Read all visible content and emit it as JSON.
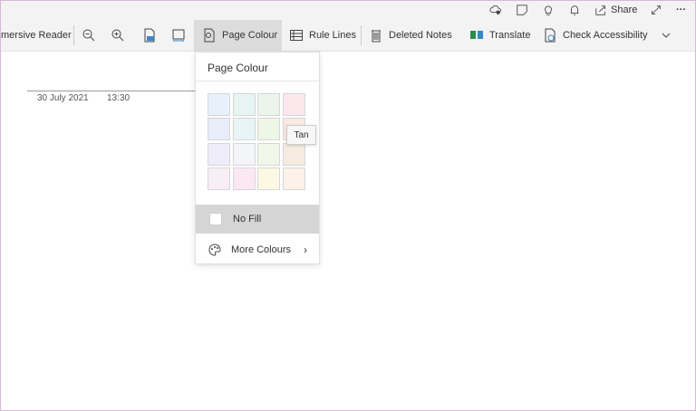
{
  "titlebar": {
    "share_label": "Share"
  },
  "toolbar": {
    "immersive_reader": "mersive Reader",
    "page_colour": "Page Colour",
    "rule_lines": "Rule Lines",
    "deleted_notes": "Deleted Notes",
    "translate": "Translate",
    "check_accessibility": "Check Accessibility"
  },
  "page": {
    "date": "30 July 2021",
    "time": "13:30"
  },
  "menu": {
    "title": "Page Colour",
    "swatches": [
      "#e8f0fc",
      "#e6f5f2",
      "#ebf5ec",
      "#fce8ec",
      "#e9ecf9",
      "#e8f5f6",
      "#eef7e6",
      "#fbe9e4",
      "#eeedf9",
      "#f4f5f8",
      "#f1f7e8",
      "#f5ebe0",
      "#f8eef6",
      "#fbe8f3",
      "#fdf8e3",
      "#fdf1e8"
    ],
    "no_fill": "No Fill",
    "more_colours": "More Colours",
    "tooltip": "Tan"
  }
}
